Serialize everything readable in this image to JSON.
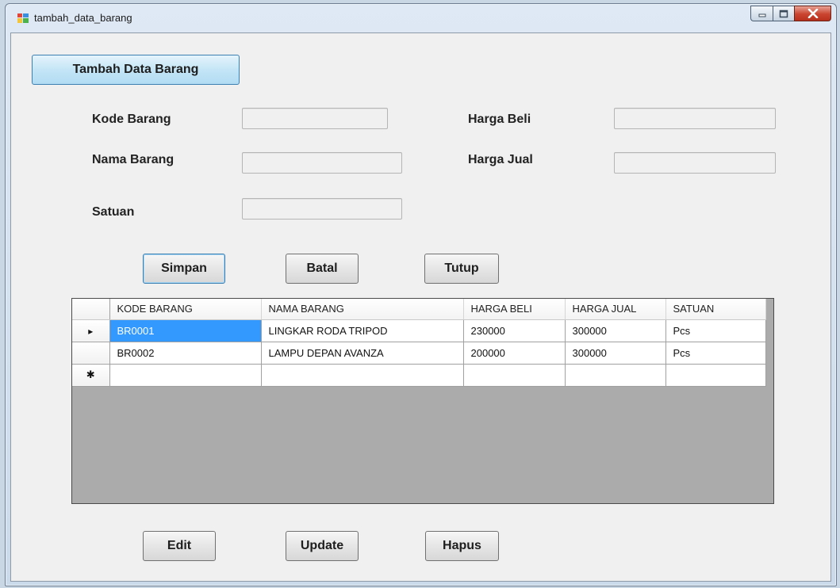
{
  "window": {
    "title": "tambah_data_barang",
    "controls": {
      "minimize": "minimize-icon",
      "maximize": "maximize-icon",
      "close": "close-icon"
    }
  },
  "form": {
    "header_button": "Tambah Data Barang",
    "labels": {
      "kode_barang": "Kode Barang",
      "nama_barang": "Nama Barang",
      "satuan": "Satuan",
      "harga_beli": "Harga Beli",
      "harga_jual": "Harga Jual"
    },
    "values": {
      "kode_barang": "",
      "nama_barang": "",
      "satuan": "",
      "harga_beli": "",
      "harga_jual": ""
    },
    "buttons": {
      "simpan": "Simpan",
      "batal": "Batal",
      "tutup": "Tutup",
      "edit": "Edit",
      "update": "Update",
      "hapus": "Hapus"
    }
  },
  "grid": {
    "columns": [
      "KODE BARANG",
      "NAMA BARANG",
      "HARGA BELI",
      "HARGA JUAL",
      "SATUAN"
    ],
    "rows": [
      [
        "BR0001",
        "LINGKAR RODA TRIPOD",
        "230000",
        "300000",
        "Pcs"
      ],
      [
        "BR0002",
        "LAMPU DEPAN AVANZA",
        "200000",
        "300000",
        "Pcs"
      ]
    ],
    "current_row_marker": "▸",
    "new_row_marker": "✱"
  },
  "colors": {
    "selection": "#3399ff",
    "grid_background": "#ababab",
    "header_button": "#c4e5f6"
  }
}
